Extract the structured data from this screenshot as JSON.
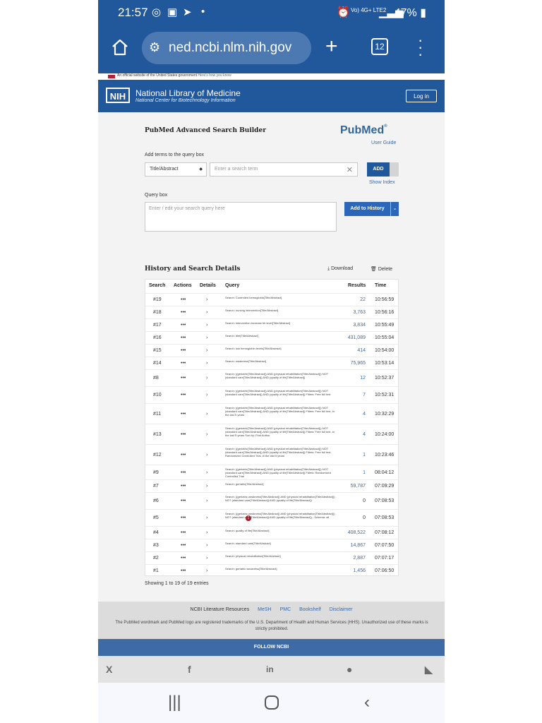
{
  "status": {
    "time": "21:57",
    "network": "Vo) 4G+ LTE2",
    "battery": "47%"
  },
  "browser": {
    "url": "ned.ncbi.nlm.nih.gov",
    "tab_count": "12"
  },
  "gov_banner": {
    "text": "An official website of the United States government",
    "link": "Here's how you know"
  },
  "header": {
    "logo": "NIH",
    "title": "National Library of Medicine",
    "subtitle": "National Center for Biotechnology Information",
    "login": "Log in"
  },
  "builder": {
    "title": "PubMed Advanced Search Builder",
    "logo": "PubMed",
    "user_guide": "User Guide",
    "add_terms_label": "Add terms to the query box",
    "field_value": "Title/Abstract",
    "term_placeholder": "Enter a search term",
    "add_label": "ADD",
    "show_index": "Show Index",
    "query_box_label": "Query box",
    "query_placeholder": "Enter / edit your search query here",
    "add_to_history": "Add to History"
  },
  "history": {
    "title": "History and Search Details",
    "download": "Download",
    "delete": "Delete",
    "columns": [
      "Search",
      "Actions",
      "Details",
      "Query",
      "Results",
      "Time"
    ],
    "rows": [
      {
        "search": "#19",
        "actions": "•••",
        "query": "Search: Controlled hemoglobin[Title/Abstract]",
        "results": "22",
        "time": "10:56:59"
      },
      {
        "search": "#18",
        "actions": "•••",
        "query": "Search: nursing intervention[Title/Abstract]",
        "results": "3,763",
        "time": "10:56:16"
      },
      {
        "search": "#17",
        "actions": "•••",
        "query": "Search: intervention increase hb level[Title/Abstract]",
        "results": "3,834",
        "time": "10:55:49"
      },
      {
        "search": "#16",
        "actions": "•••",
        "query": "Search: diet[Title/Abstract]",
        "results": "431,089",
        "time": "10:55:04"
      },
      {
        "search": "#15",
        "actions": "•••",
        "query": "Search: low hemoglobin levels[Title/Abstract]",
        "results": "414",
        "time": "10:54:00"
      },
      {
        "search": "#14",
        "actions": "•••",
        "query": "Search: weakness[Title/Abstract]",
        "results": "75,965",
        "time": "10:53:14"
      },
      {
        "search": "#8",
        "actions": "•••",
        "query": "Search: ((geriatric[Title/Abstract]) AND (physical rehabilitation[Title/Abstract])) NOT (standard care[Title/Abstract]) AND (quality of life[Title/Abstract])",
        "results": "12",
        "time": "10:52:37"
      },
      {
        "search": "#10",
        "actions": "•••",
        "query": "Search: ((geriatric[Title/Abstract]) AND (physical rehabilitation[Title/Abstract])) NOT (standard care[Title/Abstract]) AND (quality of life[Title/Abstract]) Filters: Free full text",
        "results": "7",
        "time": "10:52:31"
      },
      {
        "search": "#11",
        "actions": "•••",
        "query": "Search: ((geriatric[Title/Abstract]) AND (physical rehabilitation[Title/Abstract])) NOT (standard care[Title/Abstract]) AND (quality of life[Title/Abstract]) Filters: Free full text, in the last 5 years",
        "results": "4",
        "time": "10:32:29"
      },
      {
        "search": "#13",
        "actions": "•••",
        "query": "Search: ((geriatric[Title/Abstract]) AND (physical rehabilitation[Title/Abstract])) NOT (standard care[Title/Abstract]) AND (quality of life[Title/Abstract]) Filters: Free full text, in the last 5 years Sort by: First Author",
        "results": "4",
        "time": "10:24:00"
      },
      {
        "search": "#12",
        "actions": "•••",
        "query": "Search: ((geriatric[Title/Abstract]) AND (physical rehabilitation[Title/Abstract])) NOT (standard care[Title/Abstract]) AND (quality of life[Title/Abstract]) Filters: Free full text, Randomized Controlled Trial, in the last 5 years",
        "results": "1",
        "time": "10:23:46"
      },
      {
        "search": "#9",
        "actions": "•••",
        "query": "Search: ((geriatric[Title/Abstract]) AND (physical rehabilitation[Title/Abstract])) NOT (standard care[Title/Abstract]) AND (quality of life[Title/Abstract]) Filters: Randomized Controlled Trial",
        "results": "1",
        "time": "08:04:12"
      },
      {
        "search": "#7",
        "actions": "•••",
        "query": "Search: geriatric[Title/Abstract]",
        "results": "59,787",
        "time": "07:09:29"
      },
      {
        "search": "#6",
        "actions": "•••",
        "query": "Search: ((geriatric weakness[Title/Abstract]) AND (physical rehabilitation[Title/Abstract])) NOT (standard care[Title/Abstract]) AND (quality of life[Title/Abstract])",
        "results": "0",
        "time": "07:08:53"
      },
      {
        "search": "#5",
        "actions": "•••",
        "query": "Search: ((geriatric weakness[Title/Abstract]) AND (physical rehabilitation[Title/Abstract])) NOT (standard care[Title/Abstract]) AND (quality of life[Title/Abstract]) - Schema: all",
        "results": "0",
        "time": "07:08:53"
      },
      {
        "search": "#4",
        "actions": "•••",
        "query": "Search: quality of life[Title/Abstract]",
        "results": "408,522",
        "time": "07:08:12"
      },
      {
        "search": "#3",
        "actions": "•••",
        "query": "Search: standard care[Title/Abstract]",
        "results": "14,867",
        "time": "07:07:50"
      },
      {
        "search": "#2",
        "actions": "•••",
        "query": "Search: physical rehabilitation[Title/Abstract]",
        "results": "2,887",
        "time": "07:07:17"
      },
      {
        "search": "#1",
        "actions": "•••",
        "query": "Search: geriatric weakness[Title/Abstract]",
        "results": "1,456",
        "time": "07:06:50"
      }
    ],
    "showing": "Showing 1 to 19 of 19 entries"
  },
  "footer": {
    "resources": "NCBI Literature Resources",
    "links": [
      "MeSH",
      "PMC",
      "Bookshelf",
      "Disclaimer"
    ],
    "trademark": "The PubMed wordmark and PubMed logo are registered trademarks of the U.S. Department of Health and Human Services (HHS). Unauthorized use of these marks is strictly prohibited.",
    "follow": "FOLLOW NCBI",
    "social": [
      "X",
      "f",
      "in"
    ]
  },
  "colors": {
    "nih_blue": "#21589b",
    "link_blue": "#3b6aa7",
    "warning_red": "#b5171e"
  }
}
